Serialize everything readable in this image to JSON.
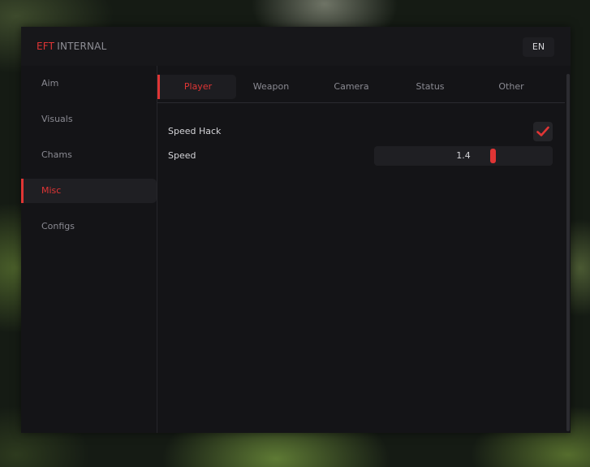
{
  "brand": {
    "accent_text": "EFT",
    "rest_text": "INTERNAL",
    "accent_color": "#e03535"
  },
  "language_button": {
    "label": "EN"
  },
  "sidebar": {
    "items": [
      {
        "label": "Aim",
        "active": false
      },
      {
        "label": "Visuals",
        "active": false
      },
      {
        "label": "Chams",
        "active": false
      },
      {
        "label": "Misc",
        "active": true
      },
      {
        "label": "Configs",
        "active": false
      }
    ]
  },
  "tabs": {
    "items": [
      {
        "label": "Player",
        "active": true
      },
      {
        "label": "Weapon",
        "active": false
      },
      {
        "label": "Camera",
        "active": false
      },
      {
        "label": "Status",
        "active": false
      },
      {
        "label": "Other",
        "active": false
      }
    ]
  },
  "settings": {
    "speed_hack": {
      "label": "Speed Hack",
      "checked": true,
      "icon": "checkmark-icon"
    },
    "speed": {
      "label": "Speed",
      "value": "1.4",
      "fill_fraction": 0.67
    }
  }
}
